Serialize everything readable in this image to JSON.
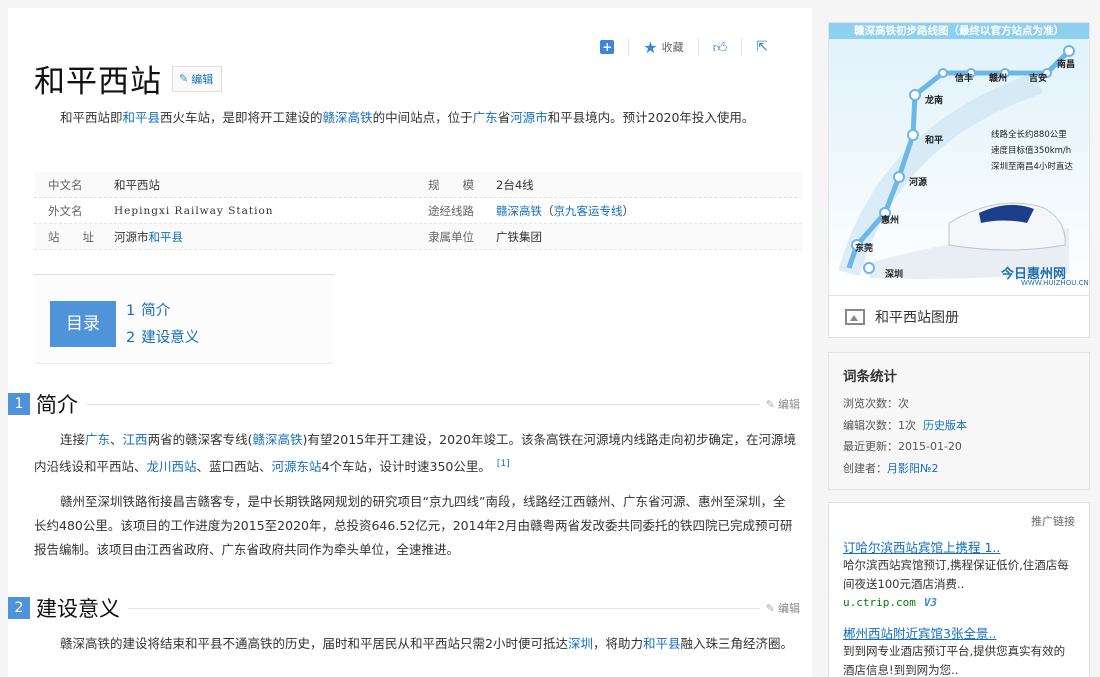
{
  "toolbar": {
    "add_icon": "plus-square-icon",
    "collect_label": "收藏",
    "like_icon": "thumbs-up-icon",
    "share_icon": "share-icon"
  },
  "entry": {
    "title": "和平西站",
    "edit_label": "编辑",
    "summary_parts": [
      "和平西站即",
      "和平县",
      "西火车站，是即将开工建设的",
      "赣深高铁",
      "的中间站点，位于",
      "广东",
      "省",
      "河源市",
      "和平县境内。预计2020年投入使用。"
    ]
  },
  "infobox": [
    {
      "k1": "中文名",
      "v1": "和平西站",
      "k2": "规　　模",
      "v2": "2台4线"
    },
    {
      "k1": "外文名",
      "v1": "Hepingxi Railway Station",
      "k2": "途经线路",
      "v2a": "赣深高铁",
      "v2b": "（",
      "v2c": "京九客运专线",
      "v2d": "）"
    },
    {
      "k1": "站　　址",
      "v1a": "河源市",
      "v1b": "和平县",
      "k2": "隶属单位",
      "v2": "广铁集团"
    }
  ],
  "toc": {
    "label": "目录",
    "items": [
      {
        "num": "1",
        "text": "简介"
      },
      {
        "num": "2",
        "text": "建设意义"
      }
    ]
  },
  "sections": [
    {
      "num": "1",
      "title": "简介",
      "edit": "编辑",
      "p1": [
        "连接",
        "广东",
        "、",
        "江西",
        "两省的赣深客专线(",
        "赣深高铁",
        ")有望2015年开工建设，2020年竣工。该条高铁在河源境内线路走向初步确定，在河源境内沿线设和平西站、",
        "龙川西站",
        "、蓝口西站、",
        "河源东站",
        "4个车站，设计时速350公里。",
        "[1]"
      ],
      "p2": "赣州至深圳铁路衔接昌吉赣客专，是中长期铁路网规划的研究项目“京九四线”南段，线路经江西赣州、广东省河源、惠州至深圳，全长约480公里。该项目的工作进度为2015至2020年，总投资646.52亿元，2014年2月由赣粤两省发改委共同委托的铁四院已完成预可研报告编制。该项目由江西省政府、广东省政府共同作为牵头单位，全速推进。"
    },
    {
      "num": "2",
      "title": "建设意义",
      "edit": "编辑",
      "p1": [
        "赣深高铁的建设将结束和平县不通高铁的历史，届时和平居民从和平西站只需2小时便可抵达",
        "深圳",
        "，将助力",
        "和平县",
        "融入珠三角经济圈。"
      ]
    }
  ],
  "map": {
    "title": "赣深高铁初步路线图（最终以官方站点为准）",
    "stations": [
      "南昌",
      "信丰",
      "赣州",
      "吉安",
      "龙南",
      "和平",
      "河源",
      "惠州",
      "东莞",
      "深圳"
    ],
    "notes": [
      "线路全长约880公里",
      "速度目标值350km/h",
      "深圳至南昌4小时直达"
    ],
    "logo": "今日惠州网",
    "logo_url": "WWW.HUIZHOU.CN",
    "album_label": "和平西站图册"
  },
  "stats": {
    "title": "词条统计",
    "views": "浏览次数：次",
    "edits_label": "编辑次数：1次",
    "history_link": "历史版本",
    "updated": "最近更新：2015-01-20",
    "creator_label": "创建者：",
    "creator": "月影阳№2"
  },
  "promo": {
    "header": "推广链接",
    "ads": [
      {
        "title": "订哈尔滨西站宾馆上携程 1..",
        "desc": "哈尔滨西站宾馆预订,携程保证低价,住酒店每间夜送100元酒店消费..",
        "url": "u.ctrip.com",
        "badge": "V3"
      },
      {
        "title": "郴州西站附近宾馆3张全景..",
        "desc": "到到网专业酒店预订平台,提供您真实有效的酒店信息!到到网为您..",
        "url": "",
        "badge": ""
      }
    ]
  },
  "colors": {
    "accent": "#4f93d8",
    "link": "#136ec2"
  }
}
